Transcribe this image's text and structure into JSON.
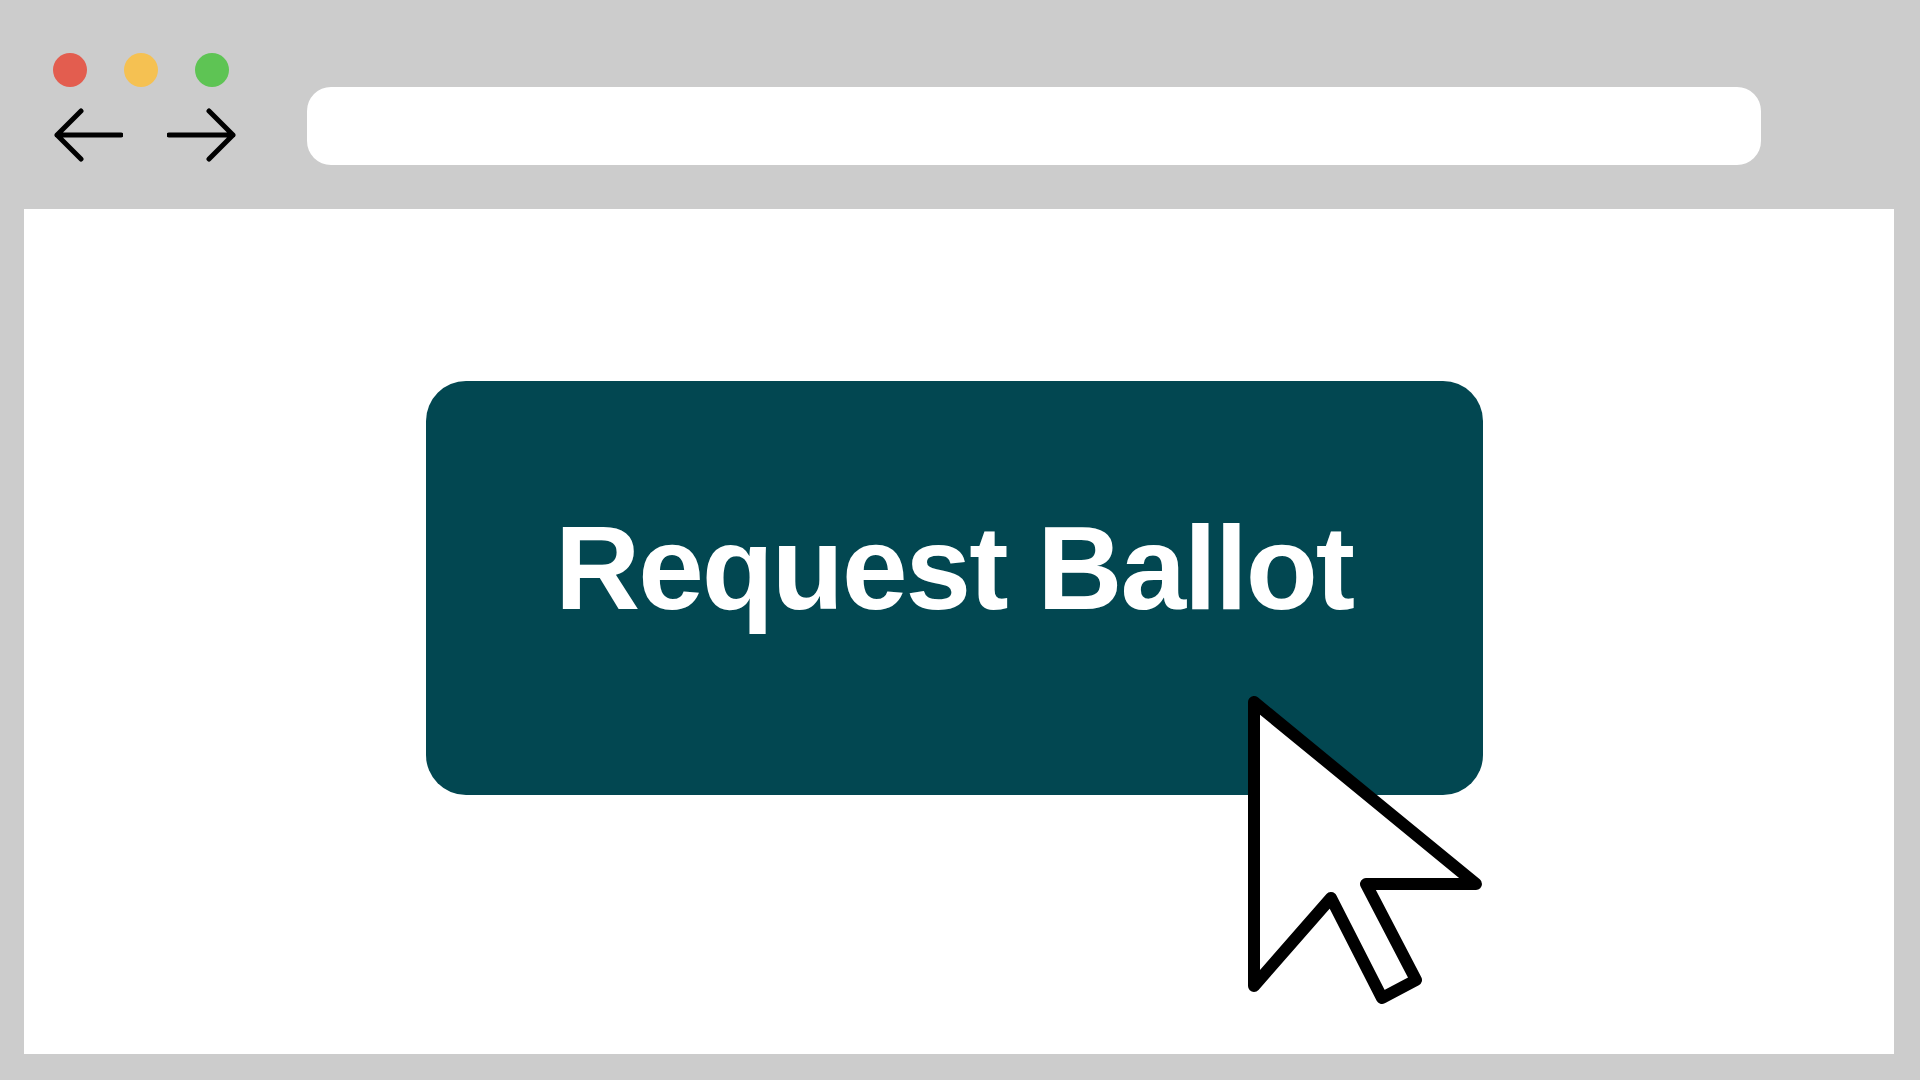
{
  "window_controls": [
    {
      "color": "#e35d4f"
    },
    {
      "color": "#f5c152"
    },
    {
      "color": "#5ec454"
    }
  ],
  "button": {
    "label": "Request Ballot"
  }
}
